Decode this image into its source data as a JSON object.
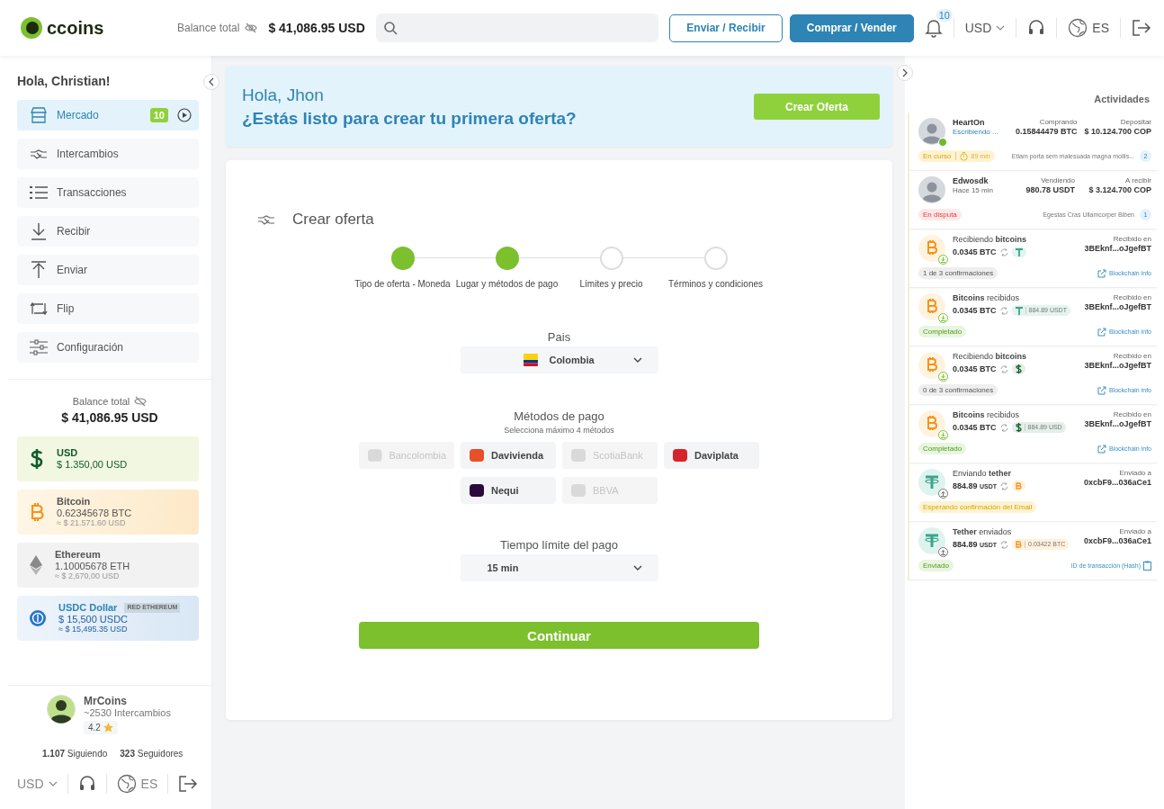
{
  "header": {
    "logo": "ccoins",
    "balance_label": "Balance total",
    "balance": "$ 41,086.95 USD",
    "buttons": [
      {
        "label": "Enviar / Recibir",
        "kind": "outline"
      },
      {
        "label": "Comprar / Vender",
        "kind": "solid"
      }
    ],
    "notifications": "10",
    "currency": "USD",
    "language": "ES"
  },
  "sidebar": {
    "greeting": "Hola, Christian!",
    "items": [
      {
        "label": "Mercado",
        "kind": "store",
        "selected": true,
        "badge": "10"
      },
      {
        "label": "Intercambios",
        "kind": "handshake",
        "selected": false
      },
      {
        "label": "Transacciones",
        "kind": "list",
        "selected": false
      },
      {
        "label": "Recibir",
        "kind": "download",
        "selected": false
      },
      {
        "label": "Enviar",
        "kind": "upload",
        "selected": false
      },
      {
        "label": "Flip",
        "kind": "flip",
        "selected": false
      },
      {
        "label": "Configuración",
        "kind": "sliders",
        "selected": false
      }
    ],
    "balance": {
      "label": "Balance total",
      "amount": "$ 41,086.95 USD"
    },
    "wallets": [
      {
        "kind": "usd",
        "name": "USD",
        "amount": "$ 1.350,00 USD"
      },
      {
        "kind": "btc",
        "name": "Bitcoin",
        "amount": "0.62345678 BTC",
        "value": "≈ $ 21.571.60 USD"
      },
      {
        "kind": "eth",
        "name": "Ethereum",
        "amount": "1.10005678 ETH",
        "value": "≈ $ 2,670,00 USD"
      },
      {
        "kind": "usdc",
        "name": "USDC Dollar",
        "tag": "RED ETHEREUM",
        "amount": "$ 15,500 USDC",
        "value": "≈ $ 15,495.35 USD"
      }
    ],
    "profile": {
      "name": "MrCoins",
      "trades": "~2530 Intercambios",
      "rating": "4.2",
      "following_count": "1.107",
      "following_label": "Siguiendo",
      "followers_count": "323",
      "followers_label": "Seguidores"
    },
    "footer": {
      "currency": "USD",
      "language": "ES"
    }
  },
  "banner": {
    "greeting": "Hola, Jhon",
    "question": "¿Estás listo para crear tu primera oferta?",
    "button": "Crear Oferta"
  },
  "form": {
    "title": "Crear oferta",
    "steps": [
      {
        "label": "Tipo de oferta - Moneda",
        "done": true
      },
      {
        "label": "Lugar y métodos de pago",
        "done": true
      },
      {
        "label": "Límites y precio",
        "done": false
      },
      {
        "label": "Términos y condiciones",
        "done": false
      }
    ],
    "country": {
      "label": "Pais",
      "value": "Colombia"
    },
    "methods": {
      "label": "Métodos de pago",
      "hint": "Selecciona máximo 4 métodos",
      "items": [
        {
          "name": "Bancolombia",
          "disabled": true,
          "color": "#d9d9d9"
        },
        {
          "name": "Davivienda",
          "disabled": false,
          "color": "#e8502a"
        },
        {
          "name": "ScotiaBank",
          "disabled": true,
          "color": "#d9d9d9"
        },
        {
          "name": "Daviplata",
          "disabled": false,
          "color": "#d8232a"
        },
        {
          "name": "Nequi",
          "disabled": false,
          "color": "#2b0a3d"
        },
        {
          "name": "BBVA",
          "disabled": true,
          "color": "#d9d9d9"
        }
      ]
    },
    "time": {
      "label": "Tiempo límite del pago",
      "value": "15 min"
    },
    "submit": "Continuar"
  },
  "activities": {
    "title": "Actividades",
    "items": [
      {
        "kind": "trade",
        "user": "HeartOn",
        "sub": "Escribiendo ...",
        "typing": true,
        "online": true,
        "mid_label": "Comprando",
        "mid_value": "0.15844479 BTC",
        "right_label": "Depositar",
        "right_value": "$ 10.124.700 COP",
        "status": "En curso",
        "color": "#fdf3d2",
        "timer": "89 min",
        "message": "Etiam porta sem malesuada magna mollis...",
        "count": "2"
      },
      {
        "kind": "trade",
        "user": "Edwosdk",
        "sub": "Hace 15 min",
        "typing": false,
        "online": false,
        "mid_label": "Vendiendo",
        "mid_value": "980.78 USDT",
        "right_label": "A recibir",
        "right_value": "$ 3.124.700 COP",
        "status": "En disputa",
        "color": "#fde8e8",
        "message": "Egestas Cras Ullamcorper Biben",
        "count": "1"
      },
      {
        "kind": "btc-receive",
        "title": "Recibiendo **bitcoins**",
        "amount": "0.0345",
        "unit": "BTC",
        "chip": {
          "kind": "usdt"
        },
        "right_label": "Recibido en",
        "address": "3BEknf...oJgefBT",
        "status": "1 de 3 confirmaciones",
        "color": "#eeeeee",
        "link": {
          "kind": "external",
          "label": "Blockchain info"
        }
      },
      {
        "kind": "btc-receive",
        "title": "**Bitcoins** recibidos",
        "amount": "0.0345",
        "unit": "BTC",
        "chip": {
          "kind": "usdt",
          "value": "884.89 USDT"
        },
        "right_label": "Recibido en",
        "address": "3BEknf...oJgefBT",
        "status": "Completado",
        "color": "#e9f5df",
        "link": {
          "kind": "external",
          "label": "Blockchain info"
        }
      },
      {
        "kind": "btc-receive",
        "title": "Recibiendo **bitcoins**",
        "amount": "0.0345",
        "unit": "BTC",
        "chip": {
          "kind": "usd"
        },
        "right_label": "Recibido en",
        "address": "3BEknf...oJgefBT",
        "status": "0 de 3 confirmaciones",
        "color": "#eeeeee",
        "link": {
          "kind": "external",
          "label": "Blockchain info"
        }
      },
      {
        "kind": "btc-receive",
        "title": "**Bitcoins** recibidos",
        "amount": "0.0345",
        "unit": "BTC",
        "chip": {
          "kind": "usd",
          "value": "884.89 USD"
        },
        "right_label": "Recibido en",
        "address": "3BEknf...oJgefBT",
        "status": "Completado",
        "color": "#e9f5df",
        "link": {
          "kind": "external",
          "label": "Blockchain info"
        }
      },
      {
        "kind": "usdt-send",
        "title": "Enviando **tether**",
        "amount": "884.89",
        "unit": "USDT",
        "chip": {
          "kind": "btc"
        },
        "right_label": "Enviado a",
        "address": "0xcbF9...036aCe1",
        "status": "Esperando confirmación del Email",
        "color": "#fdf3d2"
      },
      {
        "kind": "usdt-send",
        "title": "**Tether** enviados",
        "amount": "884.89",
        "unit": "USDT",
        "chip": {
          "kind": "btc",
          "value": "0.03422 BTC"
        },
        "right_label": "Enviado a",
        "address": "0xcbF9...036aCe1",
        "status": "Enviado",
        "color": "#e9f5df",
        "link": {
          "kind": "copy",
          "label": "ID de transacción (Hash)"
        }
      }
    ]
  }
}
